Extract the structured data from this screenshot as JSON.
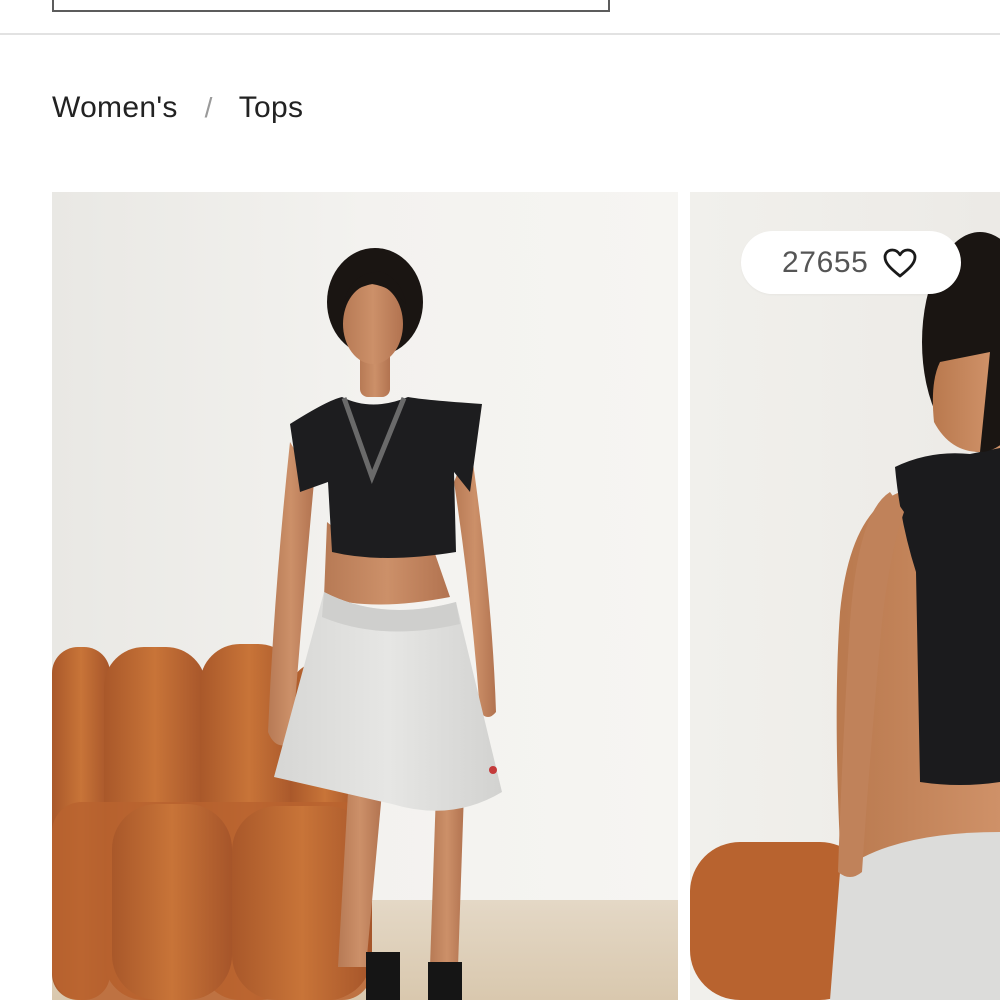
{
  "header": {
    "search": {
      "value": ""
    }
  },
  "breadcrumb": {
    "items": [
      "Women's",
      "Tops"
    ],
    "separator": "/"
  },
  "gallery": {
    "images": [
      {
        "alt": "Model wearing black cropped top and grey shorts, front view"
      },
      {
        "alt": "Model wearing black cropped top and grey shorts, side view"
      }
    ],
    "wishlist": {
      "count": "27655",
      "icon": "heart-outline-icon"
    }
  },
  "colors": {
    "text": "#222222",
    "separator": "#9a9a9a",
    "divider": "#e2e2e2",
    "border": "#5c5c5c"
  }
}
